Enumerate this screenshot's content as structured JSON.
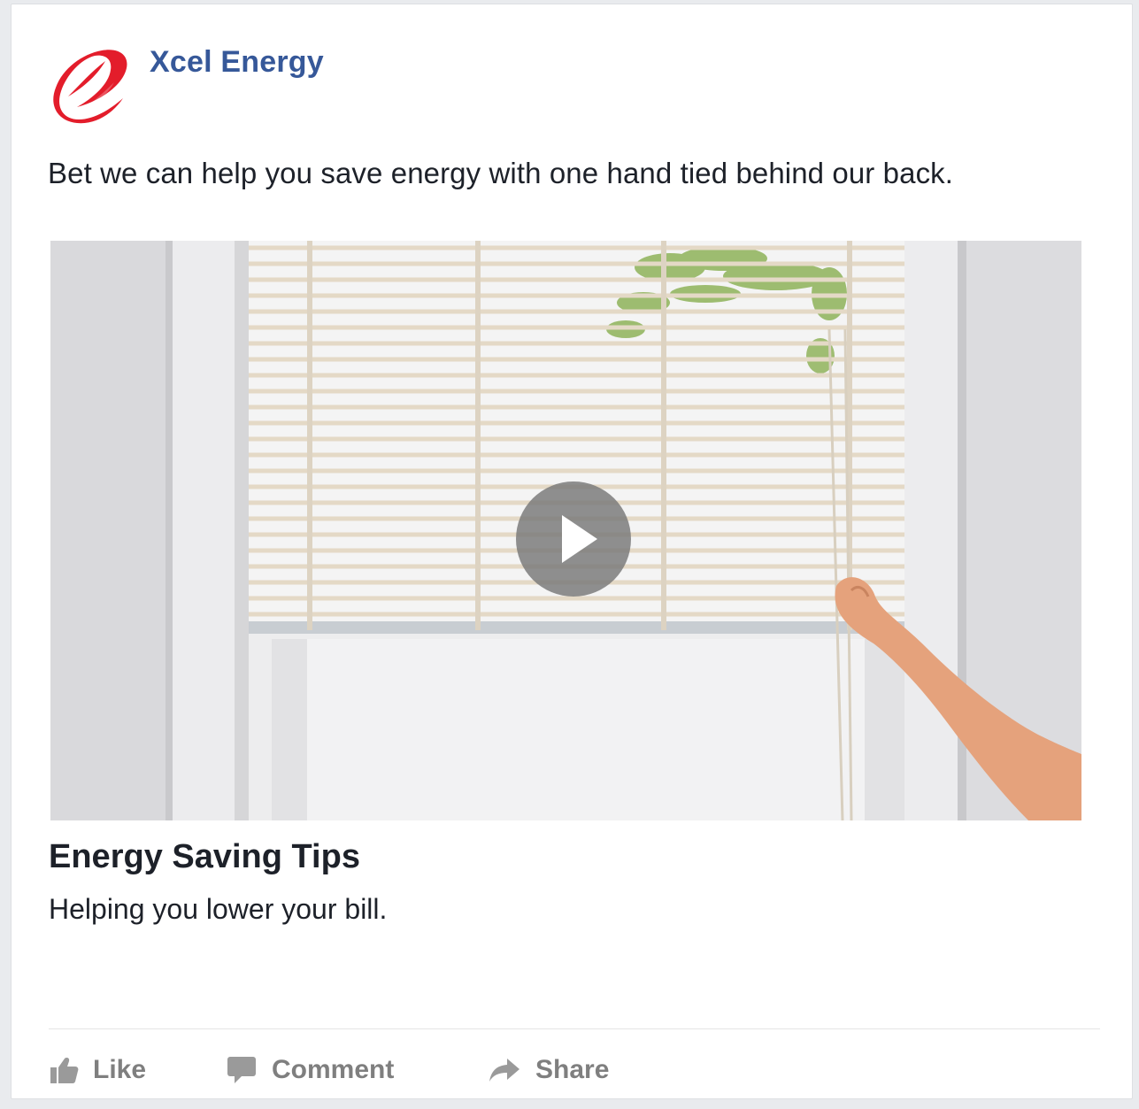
{
  "post": {
    "page_name": "Xcel Energy",
    "message": "Bet we can help you save energy with one hand tied behind our back.",
    "link": {
      "title": "Energy Saving Tips",
      "description": "Helping you lower your bill."
    },
    "media": {
      "type": "video",
      "play_icon": "play-icon"
    }
  },
  "actions": {
    "like_label": "Like",
    "comment_label": "Comment",
    "share_label": "Share"
  },
  "colors": {
    "brand_red": "#e31d2b",
    "page_name_blue": "#365899",
    "action_gray": "#7f7f7f",
    "text": "#1d2129"
  }
}
